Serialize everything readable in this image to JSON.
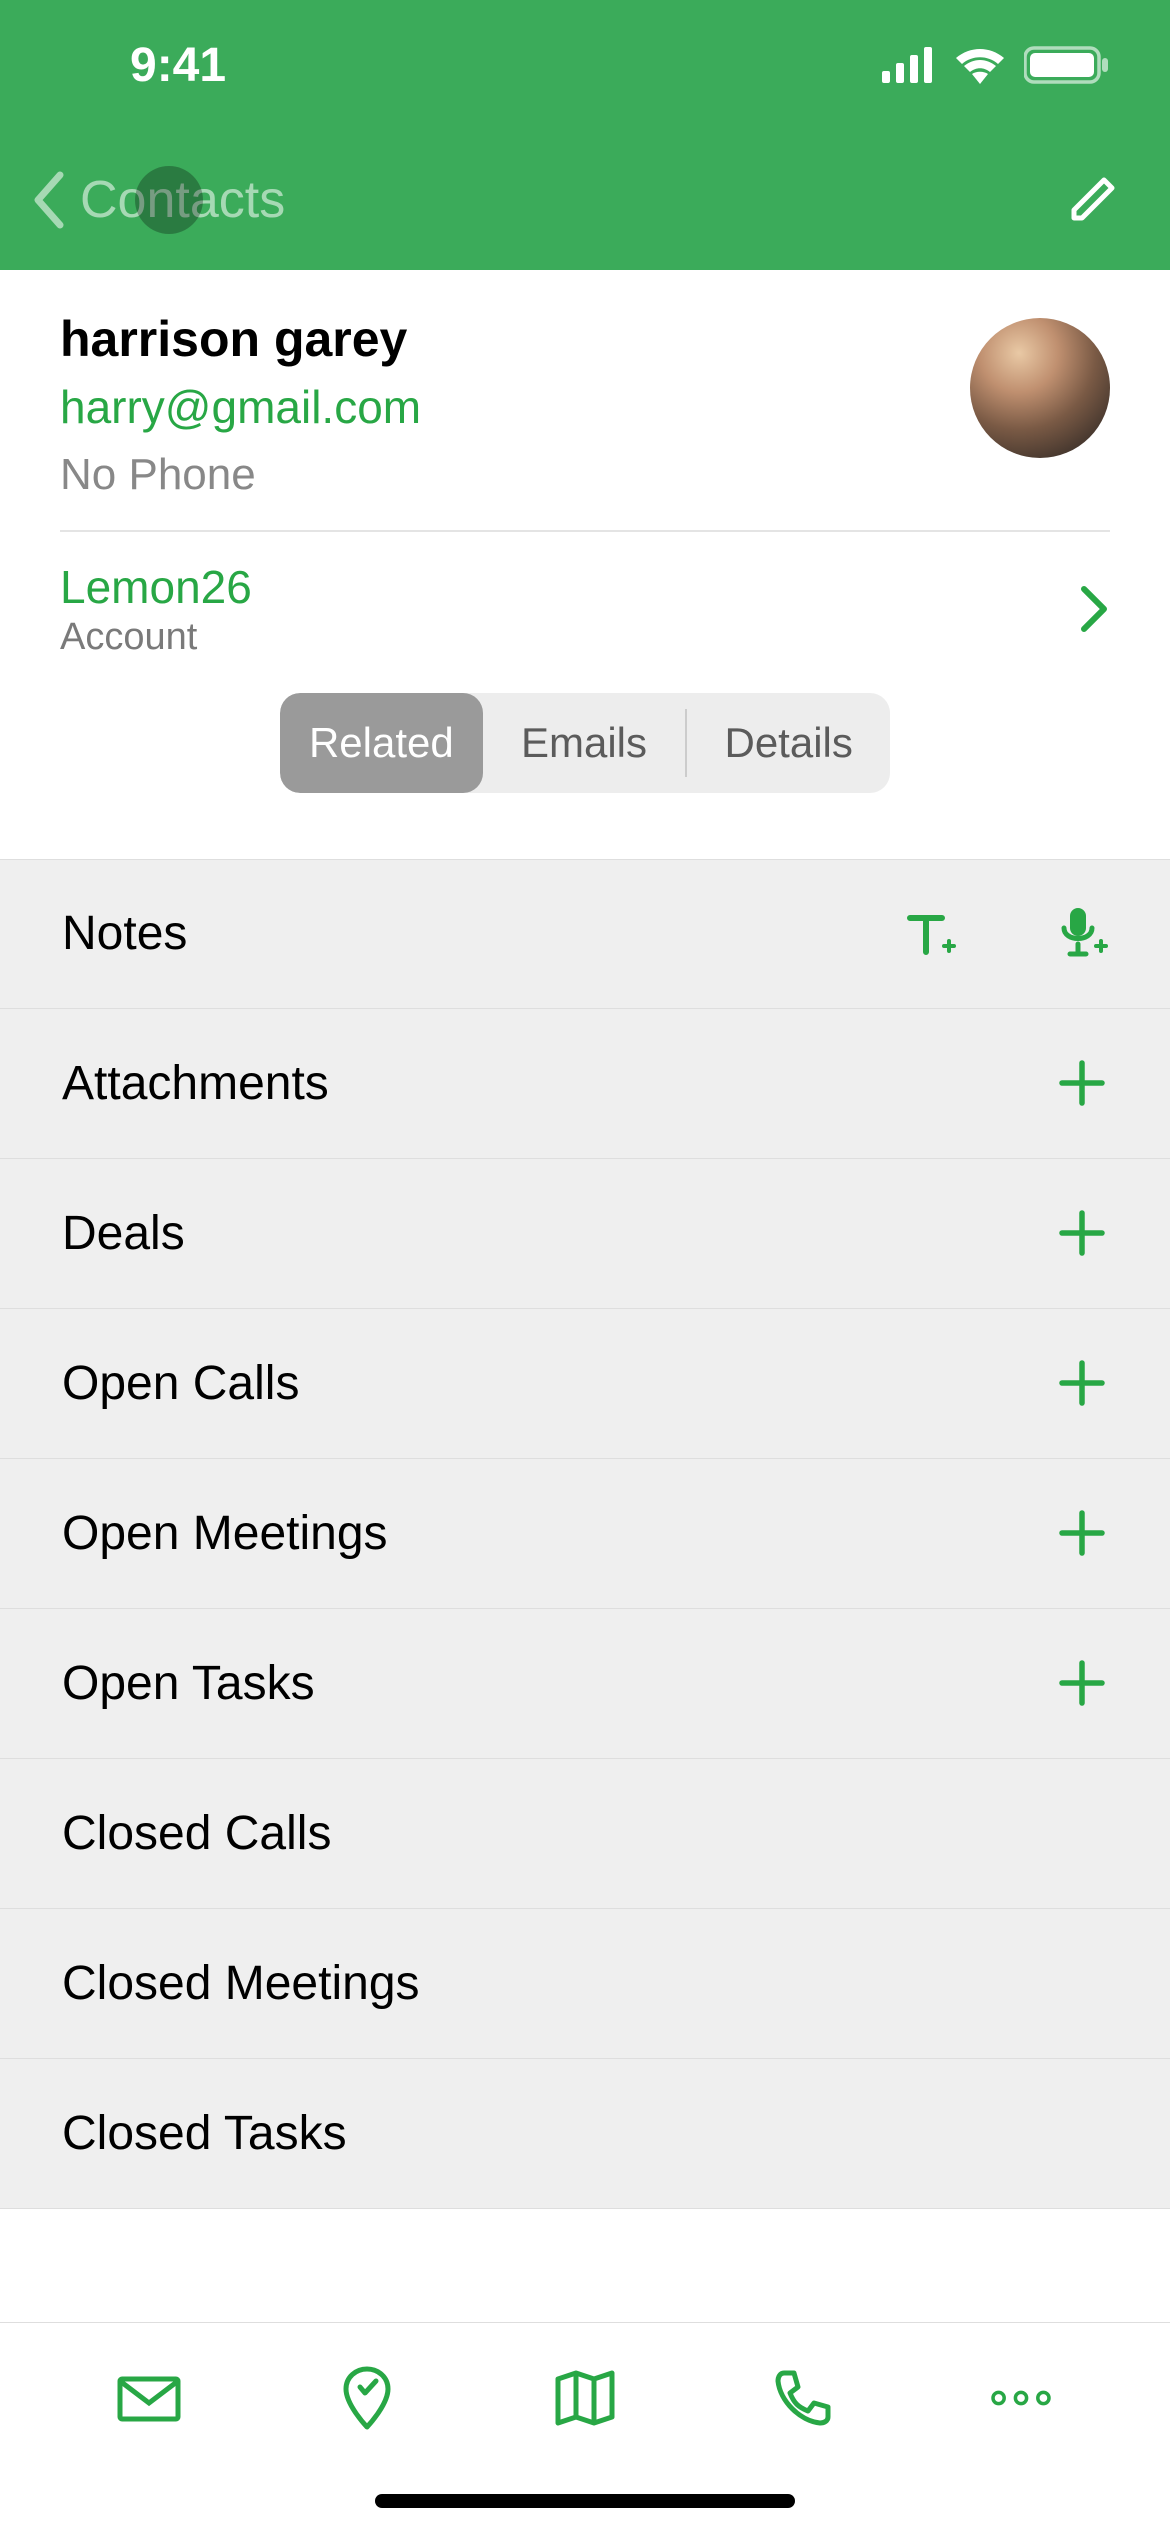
{
  "status": {
    "time": "9:41"
  },
  "nav": {
    "back_label": "Contacts"
  },
  "contact": {
    "name": "harrison garey",
    "email": "harry@gmail.com",
    "phone": "No Phone"
  },
  "account": {
    "name": "Lemon26",
    "label": "Account"
  },
  "tabs": {
    "related": "Related",
    "emails": "Emails",
    "details": "Details"
  },
  "sections": {
    "notes": "Notes",
    "attachments": "Attachments",
    "deals": "Deals",
    "open_calls": "Open Calls",
    "open_meetings": "Open Meetings",
    "open_tasks": "Open Tasks",
    "closed_calls": "Closed Calls",
    "closed_meetings": "Closed Meetings",
    "closed_tasks": "Closed Tasks"
  },
  "colors": {
    "primary": "#3bab5a",
    "accent": "#28a745"
  }
}
